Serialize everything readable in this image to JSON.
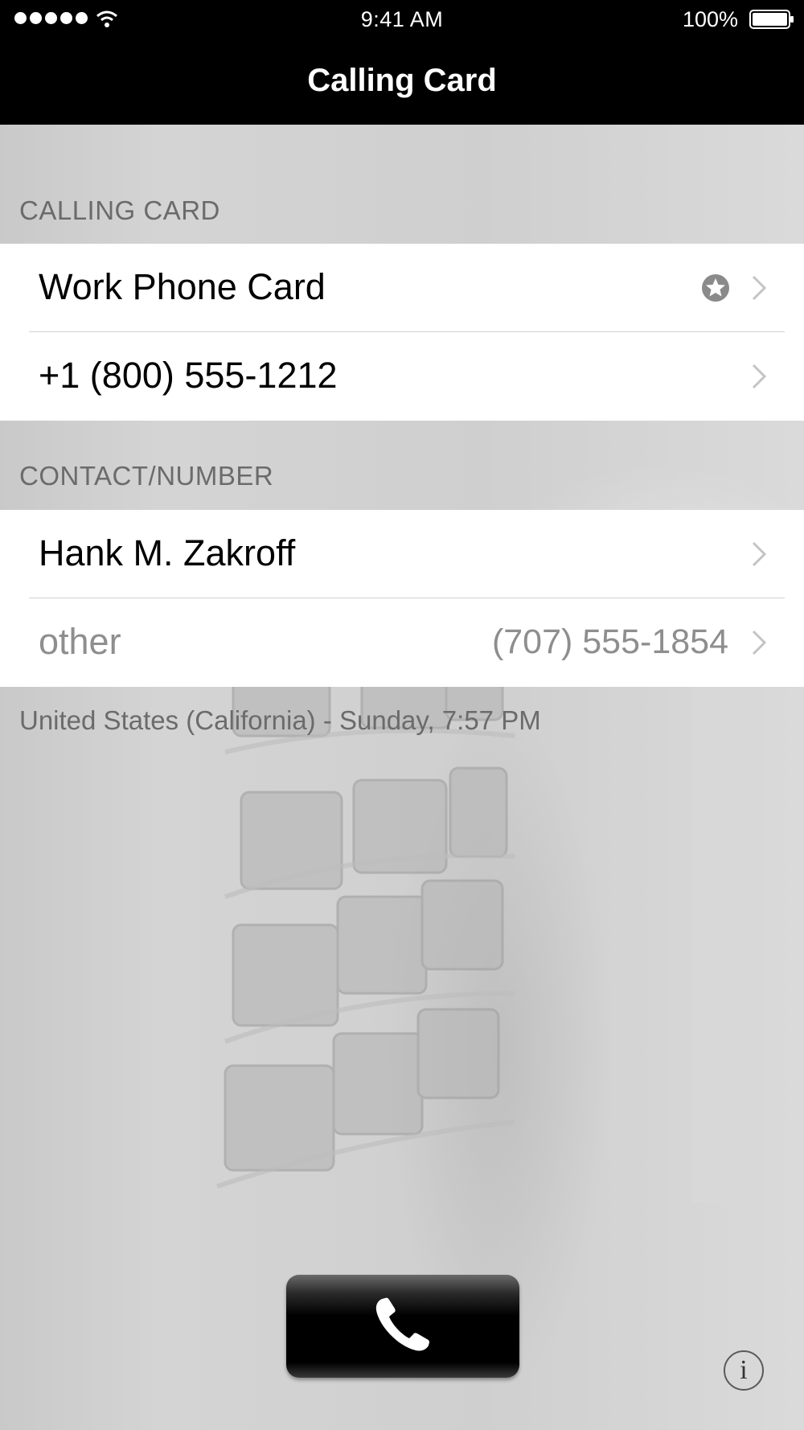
{
  "status_bar": {
    "time": "9:41 AM",
    "battery_percent": "100%",
    "battery_level": 1.0,
    "icons": [
      "signal-icon",
      "wifi-icon",
      "battery-icon"
    ]
  },
  "navbar": {
    "title": "Calling Card"
  },
  "sections": [
    {
      "header": "CALLING CARD",
      "cells": [
        {
          "label": "Work Phone Card",
          "detail": "",
          "accessory": "star-icon"
        },
        {
          "label": "+1 (800) 555-1212",
          "detail": ""
        }
      ]
    },
    {
      "header": "CONTACT/NUMBER",
      "cells": [
        {
          "label": "Hank M. Zakroff",
          "detail": ""
        },
        {
          "label": "other",
          "detail": "(707) 555-1854"
        }
      ]
    }
  ],
  "footnote": "United States (California) - Sunday, 7:57 PM",
  "call_button": {
    "icon": "phone-icon"
  },
  "info_button": {
    "glyph": "i",
    "icon": "info-icon"
  },
  "colors": {
    "bar_background": "#000000",
    "section_text": "#6b6b6b",
    "cell_background": "#ffffff",
    "muted_text": "#8e8e8e"
  }
}
